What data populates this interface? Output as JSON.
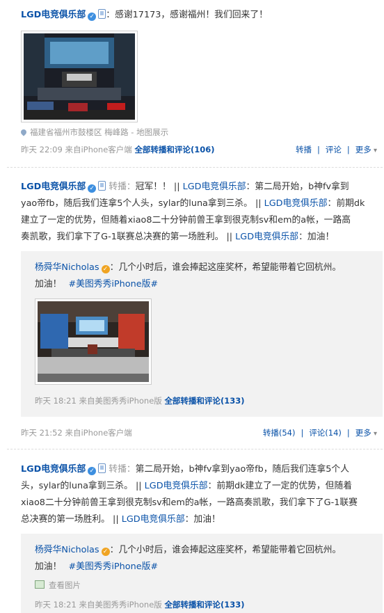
{
  "post1": {
    "author": "LGD电竞俱乐部",
    "text": "：感谢17173，感谢福州！我们回来了！",
    "location": "福建省福州市鼓楼区 梅峰路 - 地图展示",
    "time": "昨天 22:09",
    "source": "来自iPhone客户端",
    "repost_link": "全部转播和评论",
    "repost_count": "(106)",
    "actions": [
      "转播",
      "评论",
      "更多"
    ]
  },
  "post2": {
    "author": "LGD电竞俱乐部",
    "prefix": "转播：",
    "line1_text": "冠军！！ || ",
    "line1_author": "LGD电竞俱乐部",
    "line1_tail": "：第二局开始，b神fv拿到",
    "line2": "yao帝fb，随后我们连拿5个人头，sylar的luna拿到三杀。 || ",
    "line2_author": "LGD电竞俱乐部",
    "line2_tail": "：前期dk",
    "line3": "建立了一定的优势，但随着xiao8二十分钟前兽王拿到很克制sv和em的a帐，一路高",
    "line4": "奏凯歌，我们拿下了G-1联赛总决赛的第一场胜利。 || ",
    "line4_author": "LGD电竞俱乐部",
    "line4_tail": "：加油！",
    "quote": {
      "author": "杨舜华Nicholas",
      "text": "：几个小时后，谁会捧起这座奖杯，希望能带着它回杭州。",
      "line2": "加油！",
      "topic": "#美图秀秀iPhone版#",
      "time": "昨天 18:21",
      "source": "来自美图秀秀iPhone版",
      "repost_link": "全部转播和评论",
      "repost_count": "(133)"
    },
    "time": "昨天 21:52",
    "source": "来自iPhone客户端",
    "actions": [
      "转播(54)",
      "评论(14)",
      "更多"
    ]
  },
  "post3": {
    "author": "LGD电竞俱乐部",
    "prefix": "转播：",
    "line1_text": "第二局开始，b神fv拿到yao帝fb，随后我们连拿5个人",
    "line2": "头，sylar的luna拿到三杀。 || ",
    "line2_author": "LGD电竞俱乐部",
    "line2_tail": "：前期dk建立了一定的优势，但随着",
    "line3": "xiao8二十分钟前兽王拿到很克制sv和em的a帐，一路高奏凯歌，我们拿下了G-1联赛",
    "line4": "总决赛的第一场胜利。 || ",
    "line4_author": "LGD电竞俱乐部",
    "line4_tail": "：加油！",
    "quote": {
      "author": "杨舜华Nicholas",
      "text": "：几个小时后，谁会捧起这座奖杯，希望能带着它回杭州。",
      "line2": "加油！",
      "topic": "#美图秀秀iPhone版#",
      "view_image": "查看图片",
      "time": "昨天 18:21",
      "source": "来自美图秀秀iPhone版",
      "repost_link": "全部转播和评论",
      "repost_count": "(133)"
    }
  }
}
